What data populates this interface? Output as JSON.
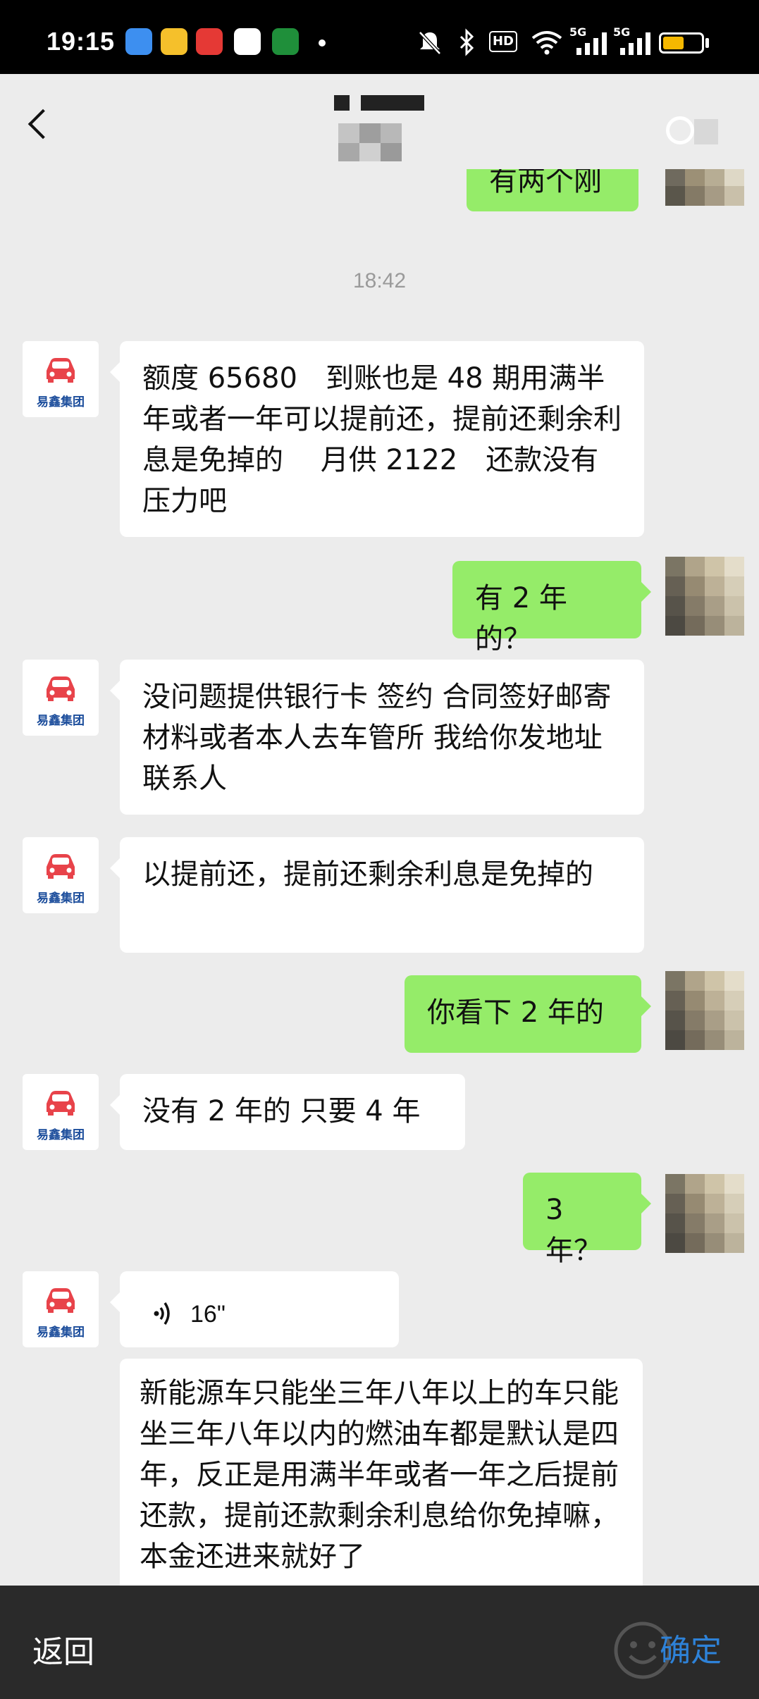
{
  "status_bar": {
    "time": "19:15",
    "hd_badge": "HD",
    "signal_1": "5G",
    "signal_2": "5G",
    "battery_level_percent": 55,
    "icons": [
      "weather-app-icon",
      "notes-app-icon",
      "toutiao-app-icon",
      "taobao-app-icon",
      "oppo-app-icon",
      "mute-icon",
      "bluetooth-icon",
      "wifi-icon"
    ]
  },
  "header": {
    "back_icon": "chevron-left-icon",
    "more_icon": "more-icon"
  },
  "chat": {
    "partial_top_message": "有两个刚",
    "timestamp": "18:42",
    "contact_badge": "易鑫集团",
    "messages": [
      {
        "side": "left",
        "text": "额度 65680　到账也是 48 期用满半年或者一年可以提前还，提前还剩余利息是免掉的　 月供 2122　还款没有压力吧"
      },
      {
        "side": "right",
        "text": "有 2 年的？"
      },
      {
        "side": "left",
        "text": "没问题提供银行卡 签约 合同签好邮寄材料或者本人去车管所 我给你发地址联系人"
      },
      {
        "side": "left",
        "text": "以提前还，提前还剩余利息是免掉的"
      },
      {
        "side": "right",
        "text": "你看下 2 年的"
      },
      {
        "side": "left",
        "text": "没有 2 年的 只要 4 年"
      },
      {
        "side": "right",
        "text": "3 年？"
      },
      {
        "side": "left",
        "type": "voice",
        "text": "16\""
      },
      {
        "side": "left",
        "text": "新能源车只能坐三年八年以上的车只能坐三年八年以内的燃油车都是默认是四年，反正是用满半年或者一年之后提前还款，提前还款剩余利息给你免掉嘛，本金还进来就好了"
      }
    ]
  },
  "bottom_bar": {
    "back_label": "返回",
    "confirm_label": "确定",
    "confirm_color": "#2e82d8"
  },
  "colors": {
    "background": "#ececec",
    "sent_bubble": "#95ec69",
    "received_bubble": "#ffffff",
    "brand_red": "#e8434a",
    "brand_blue": "#1d4e9c"
  }
}
